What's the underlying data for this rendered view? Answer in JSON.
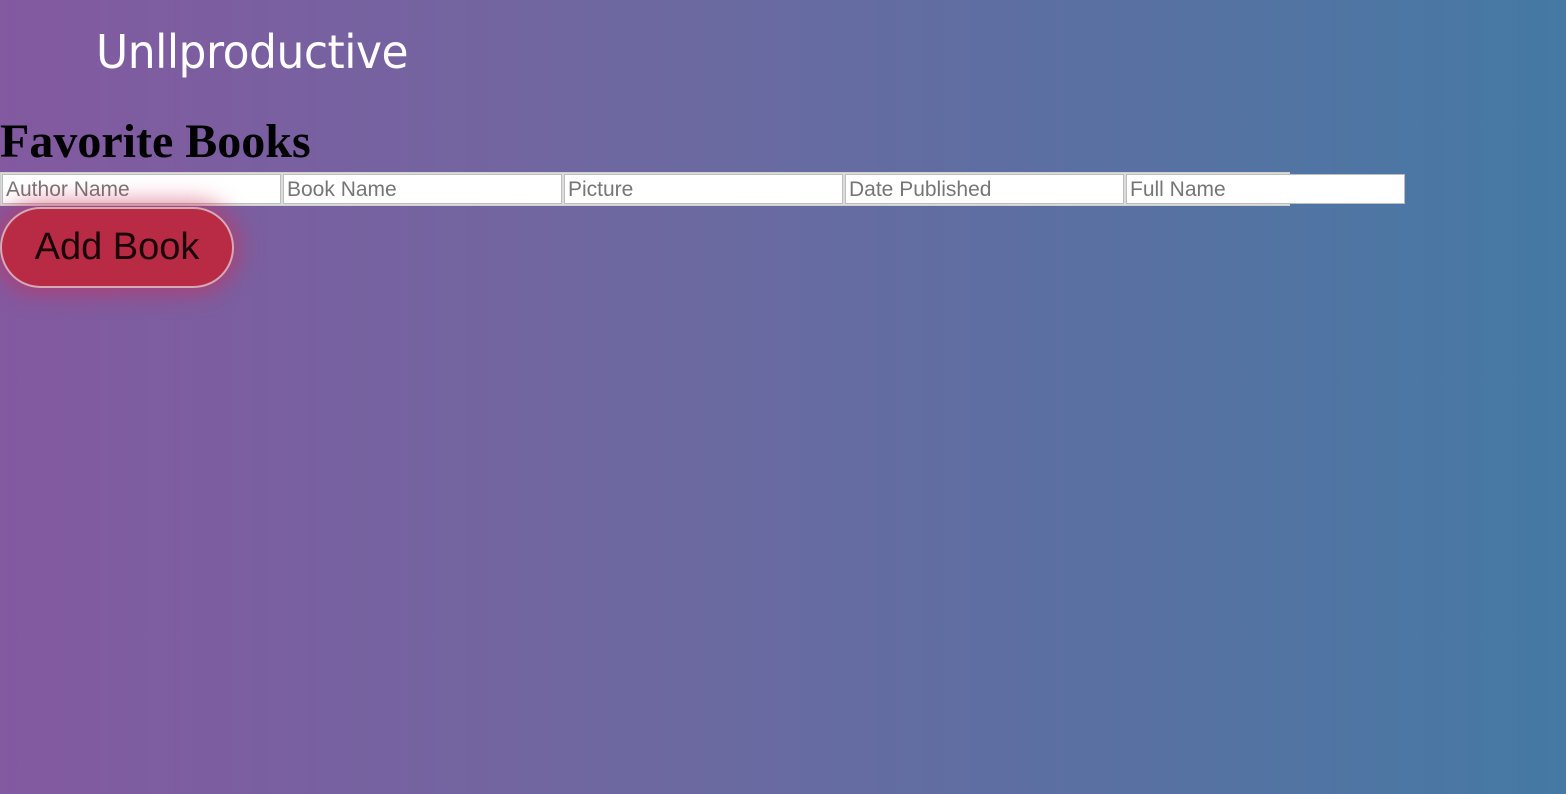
{
  "brand": {
    "logo_text": "Unllproductive"
  },
  "page": {
    "title": "Favorite Books"
  },
  "form": {
    "fields": [
      {
        "placeholder": "Author Name",
        "value": ""
      },
      {
        "placeholder": "Book Name",
        "value": ""
      },
      {
        "placeholder": "Picture",
        "value": ""
      },
      {
        "placeholder": "Date Published",
        "value": ""
      },
      {
        "placeholder": "Full Name",
        "value": ""
      }
    ],
    "submit_label": "Add Book"
  },
  "colors": {
    "button": "#b92a45",
    "background_left": "#8359a0",
    "background_right": "#4579a4"
  }
}
